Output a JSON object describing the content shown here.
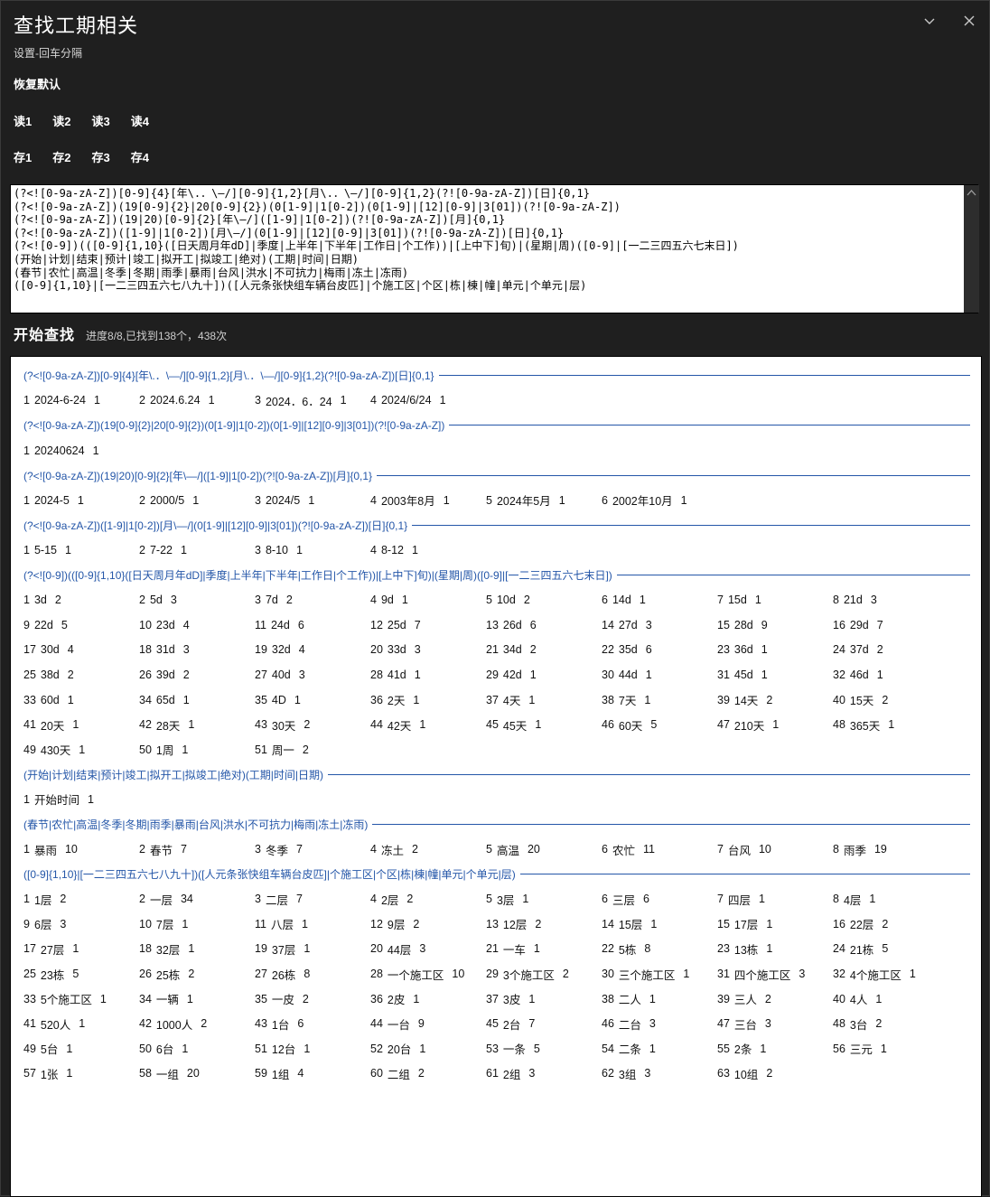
{
  "window": {
    "title": "查找工期相关",
    "subtitle": "设置-回车分隔"
  },
  "toolbar": {
    "restore_default": "恢复默认",
    "read_buttons": [
      "读1",
      "读2",
      "读3",
      "读4"
    ],
    "save_buttons": [
      "存1",
      "存2",
      "存3",
      "存4"
    ]
  },
  "patterns_input": {
    "value": "(?<![0-9a-zA-Z])[0-9]{4}[年\\.．\\—/][0-9]{1,2}[月\\.．\\—/][0-9]{1,2}(?![0-9a-zA-Z])[日]{0,1}\n(?<![0-9a-zA-Z])(19[0-9]{2}|20[0-9]{2})(0[1-9]|1[0-2])(0[1-9]|[12][0-9]|3[01])(?![0-9a-zA-Z])\n(?<![0-9a-zA-Z])(19|20)[0-9]{2}[年\\—/]([1-9]|1[0-2])(?![0-9a-zA-Z])[月]{0,1}\n(?<![0-9a-zA-Z])([1-9]|1[0-2])[月\\—/](0[1-9]|[12][0-9]|3[01])(?![0-9a-zA-Z])[日]{0,1}\n(?<![0-9])(([0-9]{1,10}([日天周月年dD]|季度|上半年|下半年|工作日|个工作))|[上中下]旬)|(星期|周)([0-9]|[一二三四五六七末日])\n(开始|计划|结束|预计|竣工|拟开工|拟竣工|绝对)(工期|时间|日期)\n(春节|农忙|高温|冬季|冬期|雨季|暴雨|台风|洪水|不可抗力|梅雨|冻土|冻雨)\n([0-9]{1,10}|[一二三四五六七八九十])([人元条张快组车辆台皮匹]|个施工区|个区|栋|棟|幢|单元|个单元|层)"
  },
  "search": {
    "start_label": "开始查找",
    "status": "进度8/8,已找到138个，438次"
  },
  "colors": {
    "window_bg": "#1f1f1f",
    "panel_bg": "#ffffff",
    "accent_blue": "#2456a8"
  },
  "results": [
    {
      "pattern": "(?<![0-9a-zA-Z])[0-9]{4}[年\\.．\\—/][0-9]{1,2}[月\\.．\\—/][0-9]{1,2}(?![0-9a-zA-Z])[日]{0,1}",
      "items": [
        [
          1,
          "2024-6-24",
          1
        ],
        [
          2,
          "2024.6.24",
          1
        ],
        [
          3,
          "2024．6．24",
          1
        ],
        [
          4,
          "2024/6/24",
          1
        ]
      ]
    },
    {
      "pattern": "(?<![0-9a-zA-Z])(19[0-9]{2}|20[0-9]{2})(0[1-9]|1[0-2])(0[1-9]|[12][0-9]|3[01])(?![0-9a-zA-Z])",
      "items": [
        [
          1,
          "20240624",
          1
        ]
      ]
    },
    {
      "pattern": "(?<![0-9a-zA-Z])(19|20)[0-9]{2}[年\\—/]([1-9]|1[0-2])(?![0-9a-zA-Z])[月]{0,1}",
      "items": [
        [
          1,
          "2024-5",
          1
        ],
        [
          2,
          "2000/5",
          1
        ],
        [
          3,
          "2024/5",
          1
        ],
        [
          4,
          "2003年8月",
          1
        ],
        [
          5,
          "2024年5月",
          1
        ],
        [
          6,
          "2002年10月",
          1
        ]
      ]
    },
    {
      "pattern": "(?<![0-9a-zA-Z])([1-9]|1[0-2])[月\\—/](0[1-9]|[12][0-9]|3[01])(?![0-9a-zA-Z])[日]{0,1}",
      "items": [
        [
          1,
          "5-15",
          1
        ],
        [
          2,
          "7-22",
          1
        ],
        [
          3,
          "8-10",
          1
        ],
        [
          4,
          "8-12",
          1
        ]
      ]
    },
    {
      "pattern": "(?<![0-9])(([0-9]{1,10}([日天周月年dD]|季度|上半年|下半年|工作日|个工作))|[上中下]旬)|(星期|周)([0-9]|[一二三四五六七末日])",
      "items": [
        [
          1,
          "3d",
          2
        ],
        [
          2,
          "5d",
          3
        ],
        [
          3,
          "7d",
          2
        ],
        [
          4,
          "9d",
          1
        ],
        [
          5,
          "10d",
          2
        ],
        [
          6,
          "14d",
          1
        ],
        [
          7,
          "15d",
          1
        ],
        [
          8,
          "21d",
          3
        ],
        [
          9,
          "22d",
          5
        ],
        [
          10,
          "23d",
          4
        ],
        [
          11,
          "24d",
          6
        ],
        [
          12,
          "25d",
          7
        ],
        [
          13,
          "26d",
          6
        ],
        [
          14,
          "27d",
          3
        ],
        [
          15,
          "28d",
          9
        ],
        [
          16,
          "29d",
          7
        ],
        [
          17,
          "30d",
          4
        ],
        [
          18,
          "31d",
          3
        ],
        [
          19,
          "32d",
          4
        ],
        [
          20,
          "33d",
          3
        ],
        [
          21,
          "34d",
          2
        ],
        [
          22,
          "35d",
          6
        ],
        [
          23,
          "36d",
          1
        ],
        [
          24,
          "37d",
          2
        ],
        [
          25,
          "38d",
          2
        ],
        [
          26,
          "39d",
          2
        ],
        [
          27,
          "40d",
          3
        ],
        [
          28,
          "41d",
          1
        ],
        [
          29,
          "42d",
          1
        ],
        [
          30,
          "44d",
          1
        ],
        [
          31,
          "45d",
          1
        ],
        [
          32,
          "46d",
          1
        ],
        [
          33,
          "60d",
          1
        ],
        [
          34,
          "65d",
          1
        ],
        [
          35,
          "4D",
          1
        ],
        [
          36,
          "2天",
          1
        ],
        [
          37,
          "4天",
          1
        ],
        [
          38,
          "7天",
          1
        ],
        [
          39,
          "14天",
          2
        ],
        [
          40,
          "15天",
          2
        ],
        [
          41,
          "20天",
          1
        ],
        [
          42,
          "28天",
          1
        ],
        [
          43,
          "30天",
          2
        ],
        [
          44,
          "42天",
          1
        ],
        [
          45,
          "45天",
          1
        ],
        [
          46,
          "60天",
          5
        ],
        [
          47,
          "210天",
          1
        ],
        [
          48,
          "365天",
          1
        ],
        [
          49,
          "430天",
          1
        ],
        [
          50,
          "1周",
          1
        ],
        [
          51,
          "周一",
          2
        ]
      ]
    },
    {
      "pattern": "(开始|计划|结束|预计|竣工|拟开工|拟竣工|绝对)(工期|时间|日期)",
      "items": [
        [
          1,
          "开始时间",
          1
        ]
      ]
    },
    {
      "pattern": "(春节|农忙|高温|冬季|冬期|雨季|暴雨|台风|洪水|不可抗力|梅雨|冻土|冻雨)",
      "items": [
        [
          1,
          "暴雨",
          10
        ],
        [
          2,
          "春节",
          7
        ],
        [
          3,
          "冬季",
          7
        ],
        [
          4,
          "冻土",
          2
        ],
        [
          5,
          "高温",
          20
        ],
        [
          6,
          "农忙",
          11
        ],
        [
          7,
          "台风",
          10
        ],
        [
          8,
          "雨季",
          19
        ]
      ]
    },
    {
      "pattern": "([0-9]{1,10}|[一二三四五六七八九十])([人元条张快组车辆台皮匹]|个施工区|个区|栋|棟|幢|单元|个单元|层)",
      "items": [
        [
          1,
          "1层",
          2
        ],
        [
          2,
          "一层",
          34
        ],
        [
          3,
          "二层",
          7
        ],
        [
          4,
          "2层",
          2
        ],
        [
          5,
          "3层",
          1
        ],
        [
          6,
          "三层",
          6
        ],
        [
          7,
          "四层",
          1
        ],
        [
          8,
          "4层",
          1
        ],
        [
          9,
          "6层",
          3
        ],
        [
          10,
          "7层",
          1
        ],
        [
          11,
          "八层",
          1
        ],
        [
          12,
          "9层",
          2
        ],
        [
          13,
          "12层",
          2
        ],
        [
          14,
          "15层",
          1
        ],
        [
          15,
          "17层",
          1
        ],
        [
          16,
          "22层",
          2
        ],
        [
          17,
          "27层",
          1
        ],
        [
          18,
          "32层",
          1
        ],
        [
          19,
          "37层",
          1
        ],
        [
          20,
          "44层",
          3
        ],
        [
          21,
          "一车",
          1
        ],
        [
          22,
          "5栋",
          8
        ],
        [
          23,
          "13栋",
          1
        ],
        [
          24,
          "21栋",
          5
        ],
        [
          25,
          "23栋",
          5
        ],
        [
          26,
          "25栋",
          2
        ],
        [
          27,
          "26栋",
          8
        ],
        [
          28,
          "一个施工区",
          10
        ],
        [
          29,
          "3个施工区",
          2
        ],
        [
          30,
          "三个施工区",
          1
        ],
        [
          31,
          "四个施工区",
          3
        ],
        [
          32,
          "4个施工区",
          1
        ],
        [
          33,
          "5个施工区",
          1
        ],
        [
          34,
          "一辆",
          1
        ],
        [
          35,
          "一皮",
          2
        ],
        [
          36,
          "2皮",
          1
        ],
        [
          37,
          "3皮",
          1
        ],
        [
          38,
          "二人",
          1
        ],
        [
          39,
          "三人",
          2
        ],
        [
          40,
          "4人",
          1
        ],
        [
          41,
          "520人",
          1
        ],
        [
          42,
          "1000人",
          2
        ],
        [
          43,
          "1台",
          6
        ],
        [
          44,
          "一台",
          9
        ],
        [
          45,
          "2台",
          7
        ],
        [
          46,
          "二台",
          3
        ],
        [
          47,
          "三台",
          3
        ],
        [
          48,
          "3台",
          2
        ],
        [
          49,
          "5台",
          1
        ],
        [
          50,
          "6台",
          1
        ],
        [
          51,
          "12台",
          1
        ],
        [
          52,
          "20台",
          1
        ],
        [
          53,
          "一条",
          5
        ],
        [
          54,
          "二条",
          1
        ],
        [
          55,
          "2条",
          1
        ],
        [
          56,
          "三元",
          1
        ],
        [
          57,
          "1张",
          1
        ],
        [
          58,
          "一组",
          20
        ],
        [
          59,
          "1组",
          4
        ],
        [
          60,
          "二组",
          2
        ],
        [
          61,
          "2组",
          3
        ],
        [
          62,
          "3组",
          3
        ],
        [
          63,
          "10组",
          2
        ]
      ]
    }
  ]
}
